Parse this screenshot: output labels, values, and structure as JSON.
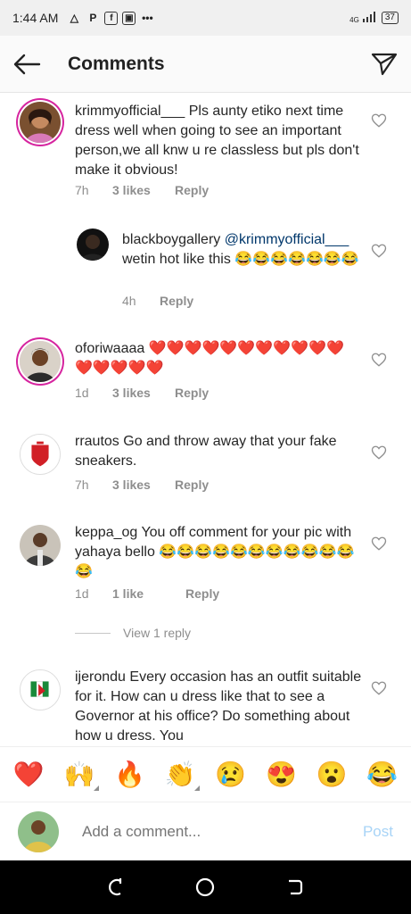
{
  "status": {
    "time": "1:44 AM",
    "battery": "37",
    "network": "4G"
  },
  "header": {
    "title": "Comments"
  },
  "comments": [
    {
      "user": "krimmyofficial___",
      "text": "Pls aunty etiko next time dress well when going to see an important person,we all knw u re classless but pls don't make it obvious!",
      "time": "7h",
      "likes": "3 likes",
      "reply": "Reply"
    },
    {
      "user": "blackboygallery",
      "mention": "@krimmyofficial___",
      "text": "wetin hot like this 😂😂😂😂😂😂😂",
      "time": "4h",
      "reply": "Reply"
    },
    {
      "user": "oforiwaaaa",
      "text": "❤️❤️❤️❤️❤️❤️❤️❤️❤️❤️❤️❤️❤️❤️❤️❤️",
      "time": "1d",
      "likes": "3 likes",
      "reply": "Reply"
    },
    {
      "user": "rrautos",
      "text": "Go and throw away that your fake sneakers.",
      "time": "7h",
      "likes": "3 likes",
      "reply": "Reply"
    },
    {
      "user": "keppa_og",
      "text": "You off comment for your pic with  yahaya bello 😂😂😂😂😂😂😂😂😂😂😂😂",
      "time": "1d",
      "likes": "1 like",
      "reply": "Reply",
      "view_replies": "View 1 reply"
    },
    {
      "user": "ijerondu",
      "text": "Every occasion has an outfit suitable for it. How can u dress like that to see a Governor at his office? Do something about how u dress. You"
    }
  ],
  "emoji_bar": [
    "❤️",
    "🙌",
    "🔥",
    "👏",
    "😢",
    "😍",
    "😮",
    "😂"
  ],
  "add_comment": {
    "placeholder": "Add a comment...",
    "post_label": "Post"
  },
  "colors": {
    "accent": "#0095f6",
    "post_disabled": "#a8d4f7",
    "heart": "#e0245e",
    "story_ring": "#d6249f"
  },
  "icons": {
    "back": "arrow-left-icon",
    "share": "paper-plane-icon",
    "like": "heart-outline-icon",
    "nav_back": "back-icon",
    "nav_home": "home-circle-icon",
    "nav_recent": "recents-icon"
  }
}
